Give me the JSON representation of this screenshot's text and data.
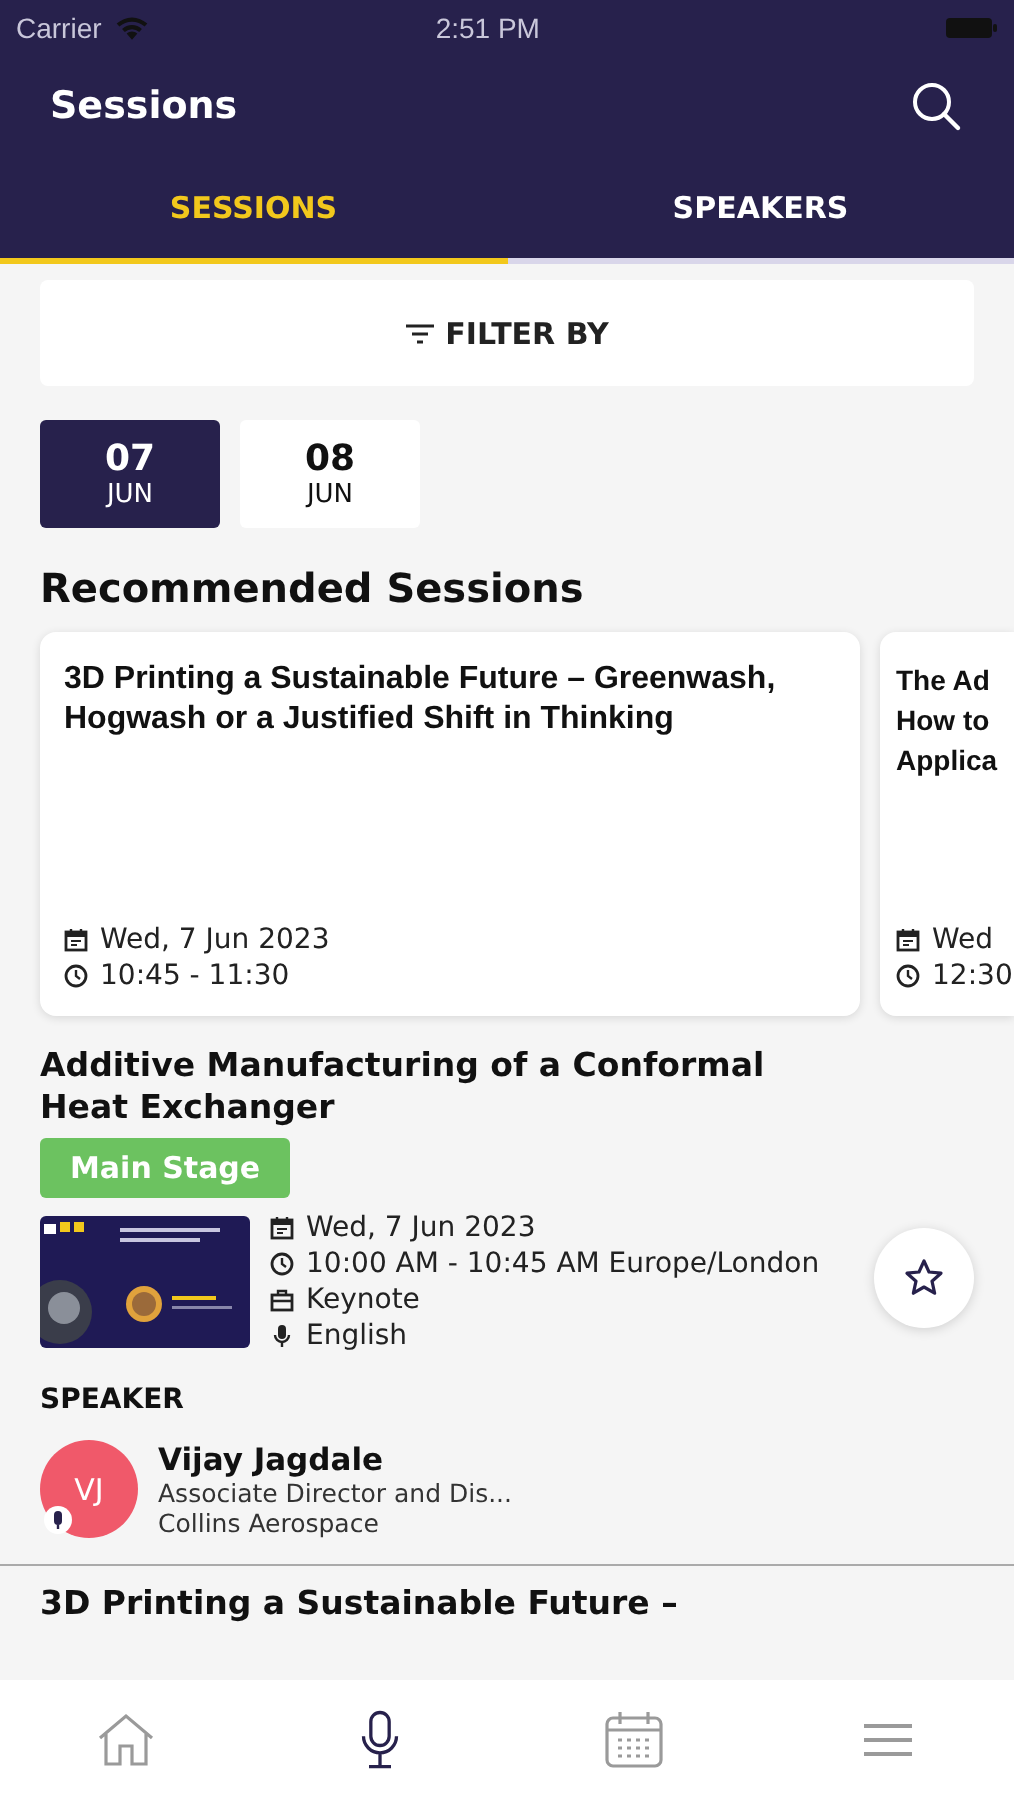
{
  "status_bar": {
    "carrier": "Carrier",
    "time": "2:51 PM"
  },
  "header": {
    "title": "Sessions"
  },
  "tabs": [
    {
      "label": "SESSIONS",
      "selected": true
    },
    {
      "label": "SPEAKERS",
      "selected": false
    }
  ],
  "filter": {
    "label": "FILTER BY"
  },
  "dates": [
    {
      "day": "07",
      "month": "JUN",
      "selected": true
    },
    {
      "day": "08",
      "month": "JUN",
      "selected": false
    }
  ],
  "recommended": {
    "heading": "Recommended Sessions",
    "cards": [
      {
        "title": "3D Printing a Sustainable Future – Greenwash, Hogwash or a  Justified Shift in Thinking",
        "date": "Wed, 7 Jun 2023",
        "time": "10:45 - 11:30"
      },
      {
        "title_lines": [
          "The Ad",
          "How to",
          "Applica"
        ],
        "date": "Wed",
        "time": "12:30"
      }
    ]
  },
  "sessions": [
    {
      "title": "Additive Manufacturing of a Conformal Heat Exchanger",
      "stage": "Main Stage",
      "thumbnail": {
        "kind": "picture"
      },
      "date": "Wed, 7 Jun 2023",
      "time": "10:00 AM - 10:45 AM Europe/London",
      "type": "Keynote",
      "language": "English",
      "favorite": false,
      "speaker_heading": "SPEAKER",
      "speakers": [
        {
          "initials": "VJ",
          "name": "Vijay Jagdale",
          "role": "Associate Director and Dis...",
          "company": "Collins Aerospace",
          "color": "#f0596a"
        }
      ]
    },
    {
      "title": "3D Printing a Sustainable Future –"
    }
  ],
  "bottom_nav": [
    {
      "selected": false
    },
    {
      "selected": true
    },
    {
      "selected": false
    },
    {
      "selected": false
    }
  ]
}
